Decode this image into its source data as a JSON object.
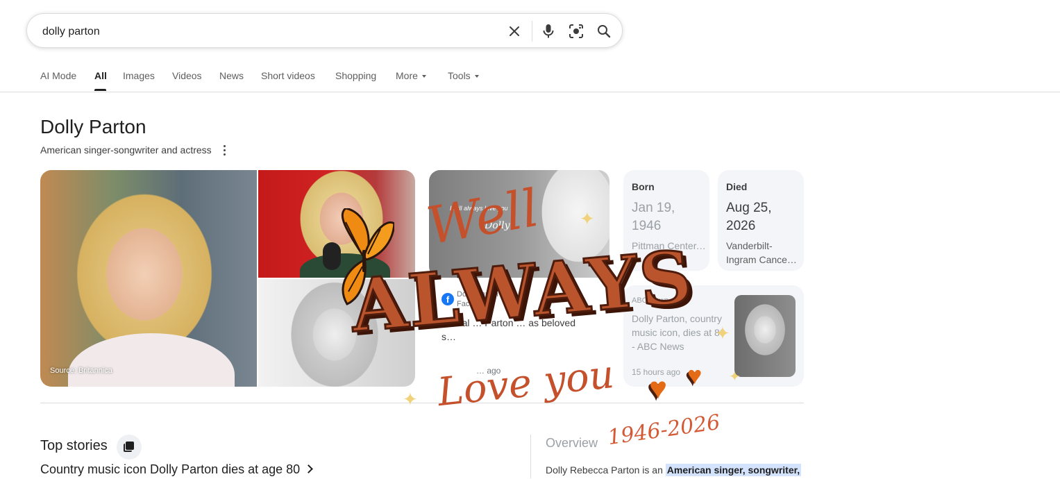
{
  "search": {
    "query": "dolly parton",
    "icons": {
      "clear": "close-icon",
      "voice": "mic-icon",
      "lens": "camera-lens-icon",
      "search": "search-icon"
    }
  },
  "tabs": [
    {
      "label": "AI Mode"
    },
    {
      "label": "All",
      "active": true
    },
    {
      "label": "Images"
    },
    {
      "label": "Videos"
    },
    {
      "label": "News"
    },
    {
      "label": "Short videos"
    },
    {
      "label": "Shopping"
    },
    {
      "label": "More"
    },
    {
      "label": "Tools"
    }
  ],
  "knowledge_panel": {
    "title": "Dolly Parton",
    "subtitle": "American singer-songwriter and actress",
    "image_source": "Source: Britannica",
    "tribute_card": {
      "quote": "I will always love you",
      "signature": "Dolly"
    },
    "born": {
      "label": "Born",
      "date": "Jan 19, 1946",
      "place": "Pittman Center, TN"
    },
    "died": {
      "label": "Died",
      "date": "Aug 25, 2026",
      "place": "Vanderbilt-Ingram Cance…"
    },
    "facebook": {
      "name": "Dolly Parton",
      "site": "Facebook",
      "snippet": "Global … Parton … as beloved s…",
      "time": "… ago"
    },
    "news_card": {
      "source": "ABC News",
      "headline": "Dolly Parton, country music icon, dies at 80 - ABC News",
      "time": "15 hours ago"
    }
  },
  "top_stories": {
    "title": "Top stories",
    "headline": "Country music icon Dolly Parton dies at age 80"
  },
  "overview": {
    "title": "Overview",
    "text_prefix": "Dolly Rebecca Parton is an ",
    "highlight": "American singer, songwriter,"
  },
  "tribute_overlay": {
    "line1": "Well",
    "line2": "ALWAYS",
    "line3": "Love you",
    "years": "1946-2026"
  },
  "colors": {
    "accent_text": "#1f1f1f",
    "muted_text": "#5e5e5e",
    "card_bg": "#f3f5f8",
    "tribute_brown": "#b9542d",
    "heart_orange": "#e46a16",
    "highlight_bg": "#d3e3fd"
  }
}
